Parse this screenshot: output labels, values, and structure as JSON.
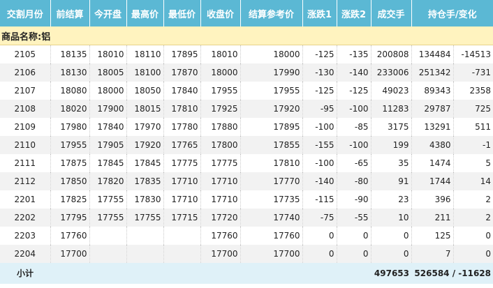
{
  "columns": [
    "交割月份",
    "前结算",
    "今开盘",
    "最高价",
    "最低价",
    "收盘价",
    "结算参考价",
    "涨跌1",
    "涨跌2",
    "成交手",
    "持仓手/变化"
  ],
  "group_label": "商品名称:铝",
  "rows": [
    [
      "2105",
      "18135",
      "18010",
      "18110",
      "17895",
      "18010",
      "18000",
      "-125",
      "-135",
      "200808",
      "134484",
      "-14513"
    ],
    [
      "2106",
      "18130",
      "18005",
      "18100",
      "17870",
      "18000",
      "17990",
      "-130",
      "-140",
      "233006",
      "251342",
      "-731"
    ],
    [
      "2107",
      "18080",
      "18000",
      "18050",
      "17840",
      "17955",
      "17955",
      "-125",
      "-125",
      "49023",
      "89343",
      "2358"
    ],
    [
      "2108",
      "18020",
      "17900",
      "18015",
      "17810",
      "17925",
      "17920",
      "-95",
      "-100",
      "11283",
      "29787",
      "725"
    ],
    [
      "2109",
      "17980",
      "17840",
      "17970",
      "17780",
      "17880",
      "17895",
      "-100",
      "-85",
      "3175",
      "13291",
      "511"
    ],
    [
      "2110",
      "17955",
      "17905",
      "17920",
      "17765",
      "17800",
      "17855",
      "-155",
      "-100",
      "199",
      "4380",
      "-1"
    ],
    [
      "2111",
      "17875",
      "17845",
      "17845",
      "17775",
      "17775",
      "17810",
      "-100",
      "-65",
      "35",
      "1474",
      "5"
    ],
    [
      "2112",
      "17850",
      "17820",
      "17835",
      "17710",
      "17710",
      "17770",
      "-140",
      "-80",
      "91",
      "1744",
      "14"
    ],
    [
      "2201",
      "17825",
      "17755",
      "17830",
      "17710",
      "17710",
      "17735",
      "-115",
      "-90",
      "23",
      "396",
      "2"
    ],
    [
      "2202",
      "17795",
      "17755",
      "17755",
      "17715",
      "17720",
      "17740",
      "-75",
      "-55",
      "10",
      "211",
      "2"
    ],
    [
      "2203",
      "17760",
      "",
      "",
      "",
      "17760",
      "17760",
      "0",
      "0",
      "0",
      "125",
      "0"
    ],
    [
      "2204",
      "17700",
      "",
      "",
      "",
      "17700",
      "17700",
      "0",
      "0",
      "0",
      "7",
      "0"
    ]
  ],
  "footer": {
    "label": "小计",
    "volume": "497653",
    "open_interest": "526584 / -11628"
  },
  "colors": {
    "header_bg": "#5bb8d4",
    "group_bg": "#fff3bf",
    "footer_bg": "#dff1f8"
  }
}
